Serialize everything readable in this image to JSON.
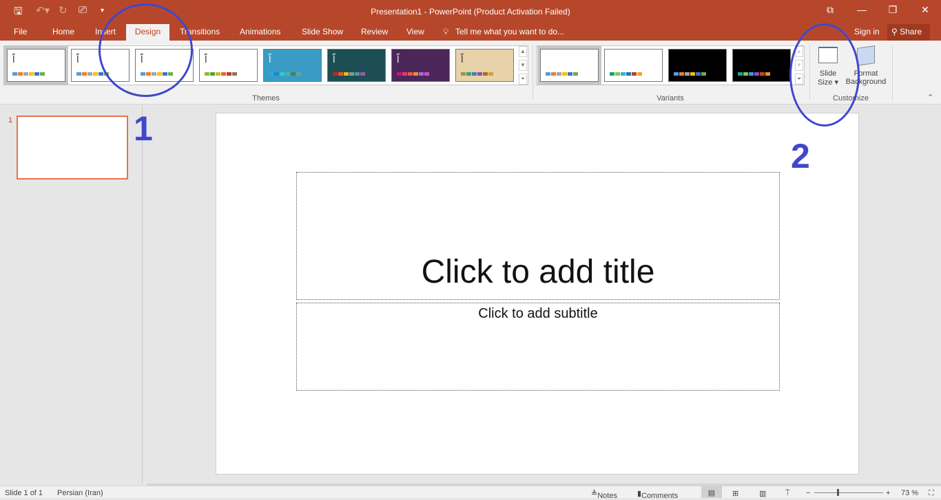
{
  "window": {
    "title": "Presentation1 - PowerPoint (Product Activation Failed)"
  },
  "quick_access": {
    "save_icon": "save-icon",
    "undo_icon": "undo-icon",
    "redo_icon": "redo-icon",
    "present_icon": "present-from-start-icon",
    "customize_icon": "customize-dropdown-icon"
  },
  "tabs": [
    "File",
    "Home",
    "Insert",
    "Design",
    "Transitions",
    "Animations",
    "Slide Show",
    "Review",
    "View"
  ],
  "active_tab": "Design",
  "tell_me": "Tell me what you want to do...",
  "sign_in": "Sign in",
  "share": "Share",
  "ribbon": {
    "themes_label": "Themes",
    "variants_label": "Variants",
    "customize_label": "Customize",
    "slide_size": [
      "Slide",
      "Size"
    ],
    "format_background": [
      "Format",
      "Background"
    ],
    "theme_glyph": "اً",
    "themes": [
      {
        "bg": "#ffffff",
        "colors": [
          "#5b9bd5",
          "#ed7d31",
          "#a5a5a5",
          "#ffc000",
          "#4472c4",
          "#70ad47"
        ],
        "selected": true
      },
      {
        "bg": "#ffffff",
        "colors": [
          "#5b9bd5",
          "#ed7d31",
          "#a5a5a5",
          "#ffc000",
          "#4472c4",
          "#70ad47"
        ]
      },
      {
        "bg": "#ffffff",
        "colors": [
          "#5b9bd5",
          "#ed7d31",
          "#a5a5a5",
          "#ffc000",
          "#4472c4",
          "#70ad47"
        ]
      },
      {
        "bg": "#ffffff",
        "colors": [
          "#8fb93b",
          "#549e39",
          "#d8b52a",
          "#e26a21",
          "#c0392b",
          "#8b7a55"
        ]
      },
      {
        "bg": "#3a9cc4",
        "colors": [
          "#1cade4",
          "#2683c6",
          "#27ced7",
          "#42ba97",
          "#3e8853",
          "#62a39f"
        ]
      },
      {
        "bg": "#1d4e55",
        "colors": [
          "#c0281e",
          "#e35e1e",
          "#e8b626",
          "#6aa98c",
          "#5e8fa6",
          "#9c5b9c"
        ]
      },
      {
        "bg": "#4b2759",
        "colors": [
          "#c0196e",
          "#e0387a",
          "#e6603a",
          "#e98d3a",
          "#a169e6",
          "#d14dc5"
        ]
      },
      {
        "bg": "#e8d2aa",
        "colors": [
          "#90a03b",
          "#3f9e6e",
          "#4d7ab6",
          "#8a5aa2",
          "#b8652b",
          "#c9a43f"
        ]
      }
    ],
    "variants": [
      {
        "bg": "#ffffff",
        "colors": [
          "#5b9bd5",
          "#ed7d31",
          "#a5a5a5",
          "#ffc000",
          "#4472c4",
          "#70ad47"
        ],
        "selected": true
      },
      {
        "bg": "#ffffff",
        "colors": [
          "#1f9e74",
          "#8bc34a",
          "#38b2c7",
          "#2473b5",
          "#b5471c",
          "#f0a22d"
        ]
      },
      {
        "bg": "#000000",
        "colors": [
          "#5b9bd5",
          "#ed7d31",
          "#a5a5a5",
          "#ffc000",
          "#4472c4",
          "#70ad47"
        ]
      },
      {
        "bg": "#000000",
        "colors": [
          "#20a383",
          "#8bc34a",
          "#3e9bd1",
          "#7e57c2",
          "#d04321",
          "#e09434"
        ]
      }
    ]
  },
  "slides_pane": {
    "number": "1"
  },
  "slide": {
    "title_placeholder": "Click to add title",
    "subtitle_placeholder": "Click to add subtitle"
  },
  "status": {
    "slide": "Slide 1 of 1",
    "language": "Persian (Iran)",
    "notes": "Notes",
    "comments": "Comments",
    "zoom": "73 %",
    "zoom_level": 73
  },
  "annotations": {
    "one": "1",
    "two": "2",
    "color": "#3f48cc"
  }
}
